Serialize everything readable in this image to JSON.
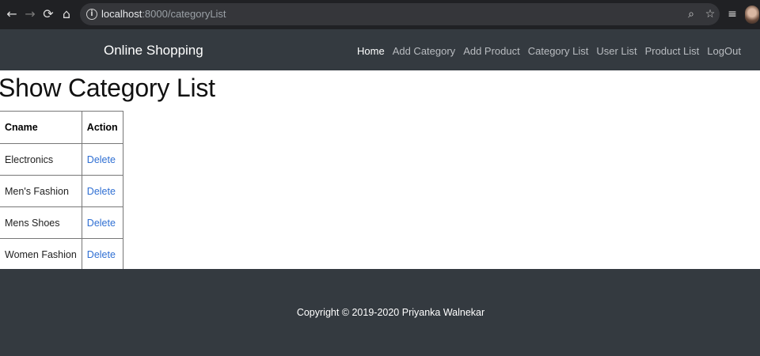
{
  "browser": {
    "back_icon": "←",
    "forward_icon": "→",
    "reload_icon": "⟳",
    "home_icon": "⌂",
    "url_host": "localhost",
    "url_rest": ":8000/categoryList",
    "zoom_icon": "⌕",
    "star_icon": "☆",
    "playlist_icon": "≡"
  },
  "navbar": {
    "brand": "Online Shopping",
    "links": [
      "Home",
      "Add Category",
      "Add Product",
      "Category List",
      "User List",
      "Product List",
      "LogOut"
    ],
    "active": "Home"
  },
  "main": {
    "title": "Show Category List",
    "table": {
      "headers": [
        "Cname",
        "Action"
      ],
      "rows": [
        {
          "name": "Electronics",
          "action": "Delete"
        },
        {
          "name": "Men's Fashion",
          "action": "Delete"
        },
        {
          "name": "Mens Shoes",
          "action": "Delete"
        },
        {
          "name": "Women Fashion",
          "action": "Delete"
        }
      ]
    }
  },
  "footer": {
    "copyright": "Copyright © 2019-2020 Priyanka Walnekar"
  },
  "colors": {
    "navbar_bg": "#343a40",
    "browser_bg": "#202124",
    "link": "#2f6fd3"
  }
}
